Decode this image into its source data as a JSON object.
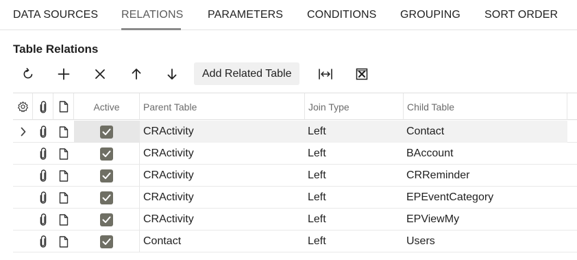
{
  "tabs": [
    {
      "label": "DATA SOURCES"
    },
    {
      "label": "RELATIONS"
    },
    {
      "label": "PARAMETERS"
    },
    {
      "label": "CONDITIONS"
    },
    {
      "label": "GROUPING"
    },
    {
      "label": "SORT ORDER"
    }
  ],
  "active_tab": "RELATIONS",
  "section": {
    "title": "Table Relations"
  },
  "toolbar": {
    "buttons": [
      {
        "icon": "refresh-icon"
      },
      {
        "icon": "plus-icon"
      },
      {
        "icon": "close-icon"
      },
      {
        "icon": "arrow-up-icon"
      },
      {
        "icon": "arrow-down-icon"
      }
    ],
    "add_related_label": "Add Related Table",
    "fit_icon": "fit-columns-icon",
    "excel_icon": "excel-export-icon"
  },
  "grid": {
    "columns": {
      "settings_icon": "gear-icon",
      "attach_icon": "paperclip-icon",
      "notes_icon": "document-icon",
      "active": "Active",
      "parent": "Parent Table",
      "join": "Join Type",
      "child": "Child Table"
    },
    "rows": [
      {
        "active": true,
        "parent": "CRActivity",
        "join": "Left",
        "child": "Contact",
        "selected": true
      },
      {
        "active": true,
        "parent": "CRActivity",
        "join": "Left",
        "child": "BAccount",
        "selected": false
      },
      {
        "active": true,
        "parent": "CRActivity",
        "join": "Left",
        "child": "CRReminder",
        "selected": false
      },
      {
        "active": true,
        "parent": "CRActivity",
        "join": "Left",
        "child": "EPEventCategory",
        "selected": false
      },
      {
        "active": true,
        "parent": "CRActivity",
        "join": "Left",
        "child": "EPViewMy",
        "selected": false
      },
      {
        "active": true,
        "parent": "Contact",
        "join": "Left",
        "child": "Users",
        "selected": false
      }
    ]
  },
  "colors": {
    "accent": "#8a8a8a",
    "checkbox": "#6f6f64",
    "selected_row": "#f2f2f2"
  }
}
